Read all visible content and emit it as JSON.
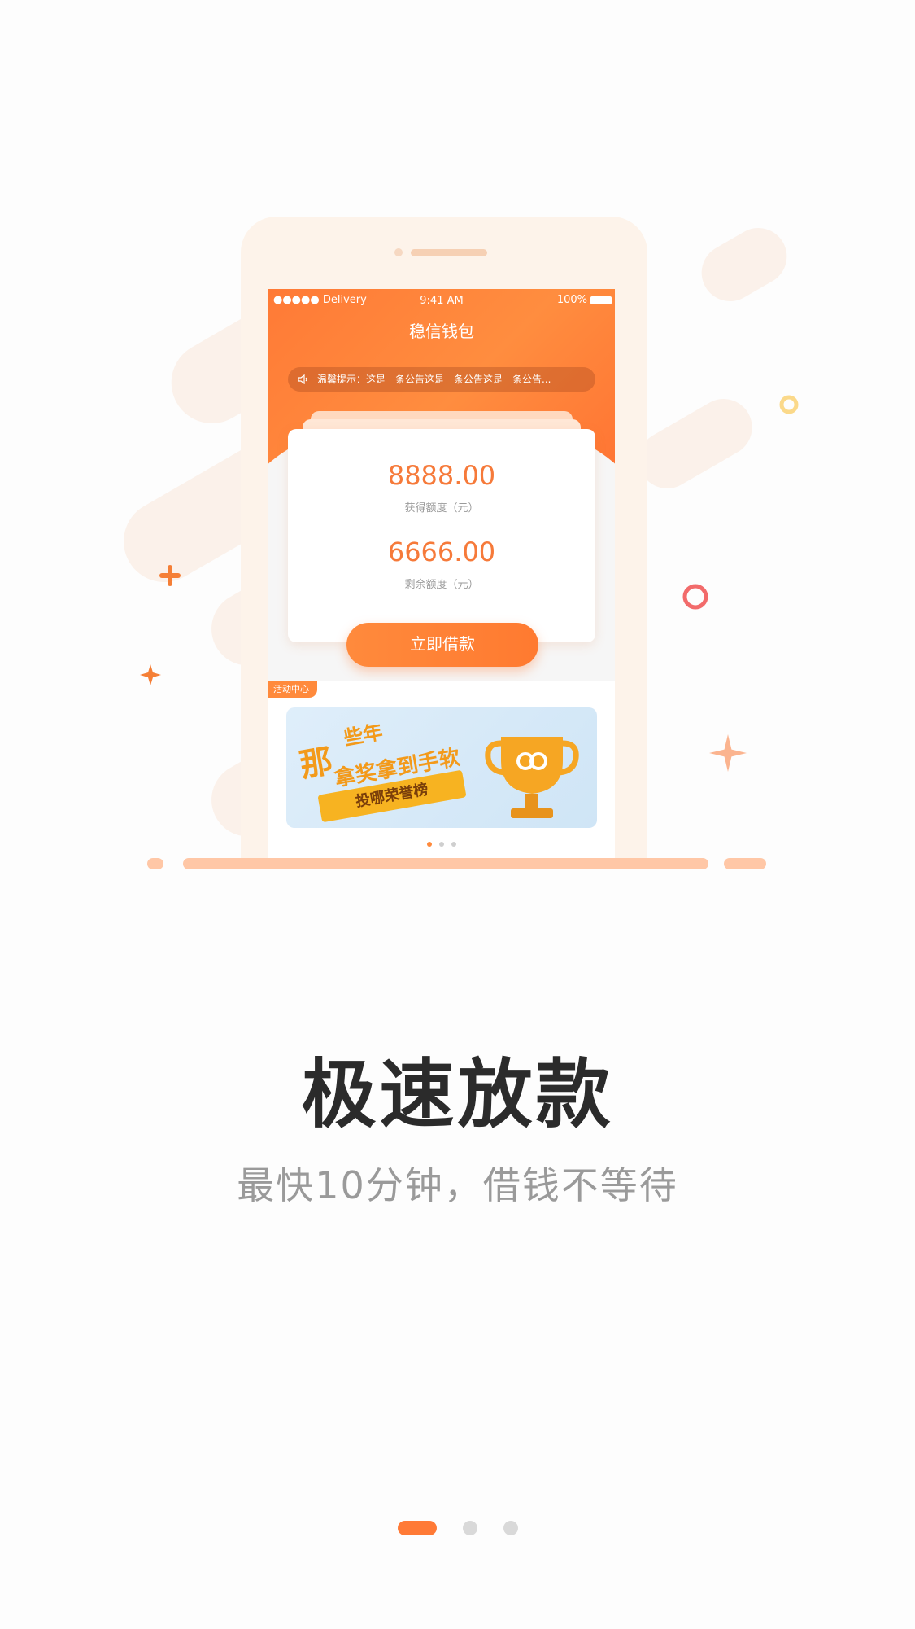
{
  "status_bar": {
    "carrier": "●●●●● Delivery",
    "time": "9:41 AM",
    "battery": "100%"
  },
  "app": {
    "title": "稳信钱包"
  },
  "notice": {
    "text": "温馨提示：这是一条公告这是一条公告这是一条公告..."
  },
  "card": {
    "obtained_amount": "8888.00",
    "obtained_label": "获得额度（元）",
    "remaining_amount": "6666.00",
    "remaining_label": "剩余额度（元）"
  },
  "borrow_button": {
    "label": "立即借款"
  },
  "activity": {
    "tag": "活动中心",
    "banner_big_char": "那",
    "banner_line1": "些年",
    "banner_line2": "拿奖拿到手软",
    "banner_ribbon": "投哪荣誉榜"
  },
  "onboarding": {
    "headline": "极速放款",
    "subline": "最快10分钟，借钱不等待",
    "page_index": 1,
    "page_count": 3
  },
  "colors": {
    "accent": "#ff7a36",
    "headline": "#2b2b2b",
    "subline": "#9a9a9a"
  },
  "icons": [
    "speaker-icon",
    "wifi-icon",
    "battery-icon",
    "trophy-icon",
    "plus-icon",
    "sparkle-icon",
    "ring-icon"
  ]
}
